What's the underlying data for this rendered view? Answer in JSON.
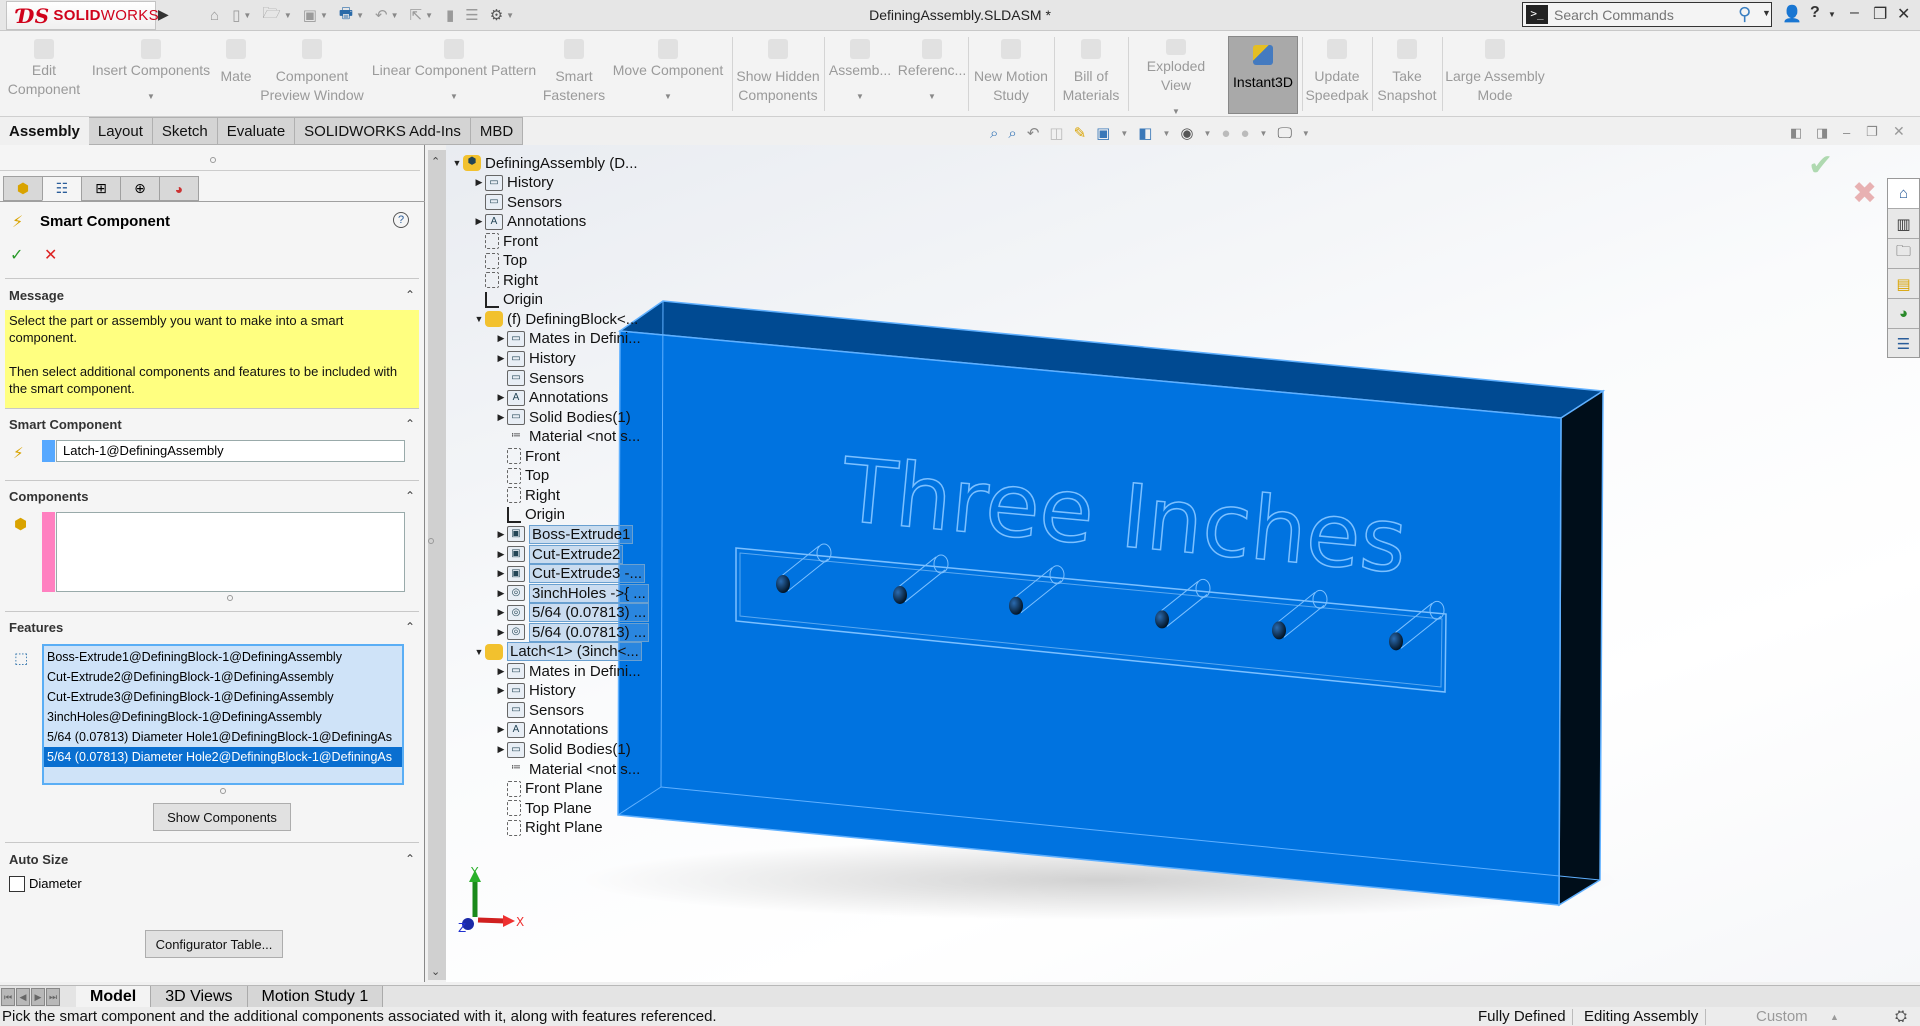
{
  "app": {
    "logo_prefix": "ƊS",
    "logo_bold": "SOLID",
    "logo_light": "WORKS",
    "document_title": "DefiningAssembly.SLDASM *"
  },
  "search": {
    "placeholder": "Search Commands"
  },
  "quick_access": [
    "home-icon",
    "new-document-icon",
    "open-icon",
    "save-icon",
    "print-icon",
    "undo-icon",
    "select-icon",
    "rebuild-icon",
    "file-properties-icon",
    "options-icon"
  ],
  "command_manager": {
    "commands": [
      {
        "label": "Edit\nComponent",
        "has_menu": false,
        "active": false
      },
      {
        "label": "Insert Components",
        "has_menu": true,
        "active": false
      },
      {
        "label": "Mate",
        "has_menu": false,
        "active": false
      },
      {
        "label": "Component\nPreview Window",
        "has_menu": false,
        "active": false
      },
      {
        "label": "Linear Component Pattern",
        "has_menu": true,
        "active": false
      },
      {
        "label": "Smart\nFasteners",
        "has_menu": false,
        "active": false
      },
      {
        "label": "Move Component",
        "has_menu": true,
        "active": false
      },
      {
        "label": "Show Hidden\nComponents",
        "has_menu": false,
        "active": false
      },
      {
        "label": "Assemb...",
        "has_menu": true,
        "active": false
      },
      {
        "label": "Referenc...",
        "has_menu": true,
        "active": false
      },
      {
        "label": "New Motion\nStudy",
        "has_menu": false,
        "active": false
      },
      {
        "label": "Bill of\nMaterials",
        "has_menu": false,
        "active": false
      },
      {
        "label": "Exploded View",
        "has_menu": true,
        "active": false
      },
      {
        "label": "Instant3D",
        "has_menu": false,
        "active": true
      },
      {
        "label": "Update\nSpeedpak",
        "has_menu": false,
        "active": false
      },
      {
        "label": "Take\nSnapshot",
        "has_menu": false,
        "active": false
      },
      {
        "label": "Large Assembly\nMode",
        "has_menu": false,
        "active": false
      }
    ],
    "tabs": [
      "Assembly",
      "Layout",
      "Sketch",
      "Evaluate",
      "SOLIDWORKS Add-Ins",
      "MBD"
    ],
    "active_tab": "Assembly"
  },
  "property_manager": {
    "title": "Smart Component",
    "ok_label": "✓",
    "cancel_label": "✕",
    "help_label": "?",
    "message": {
      "title": "Message",
      "line1": "Select the part or assembly you want to make into a smart component.",
      "line2": "Then select additional components and features to be included with the smart component."
    },
    "smart_component": {
      "title": "Smart Component",
      "value": "Latch-1@DefiningAssembly"
    },
    "components": {
      "title": "Components",
      "items": []
    },
    "features": {
      "title": "Features",
      "items": [
        "Boss-Extrude1@DefiningBlock-1@DefiningAssembly",
        "Cut-Extrude2@DefiningBlock-1@DefiningAssembly",
        "Cut-Extrude3@DefiningBlock-1@DefiningAssembly",
        "3inchHoles@DefiningBlock-1@DefiningAssembly",
        "5/64 (0.07813) Diameter Hole1@DefiningBlock-1@DefiningAs",
        "5/64 (0.07813) Diameter Hole2@DefiningBlock-1@DefiningAs"
      ],
      "selected_index": 5,
      "show_components_label": "Show Components"
    },
    "auto_size": {
      "title": "Auto Size",
      "diameter_label": "Diameter",
      "diameter_checked": false
    },
    "configurator_label": "Configurator Table..."
  },
  "feature_tree": [
    {
      "label": "DefiningAssembly  (D...",
      "icon": "assembly",
      "expander": "down",
      "level": 0,
      "highlight": false
    },
    {
      "label": "History",
      "icon": "folder",
      "expander": "right",
      "level": 1,
      "highlight": false
    },
    {
      "label": "Sensors",
      "icon": "folder",
      "expander": "",
      "level": 1,
      "highlight": false
    },
    {
      "label": "Annotations",
      "icon": "annotation",
      "expander": "right",
      "level": 1,
      "highlight": false
    },
    {
      "label": "Front",
      "icon": "plane",
      "expander": "",
      "level": 1,
      "highlight": false
    },
    {
      "label": "Top",
      "icon": "plane",
      "expander": "",
      "level": 1,
      "highlight": false
    },
    {
      "label": "Right",
      "icon": "plane",
      "expander": "",
      "level": 1,
      "highlight": false
    },
    {
      "label": "Origin",
      "icon": "origin",
      "expander": "",
      "level": 1,
      "highlight": false
    },
    {
      "label": "(f) DefiningBlock<...",
      "icon": "part",
      "expander": "down",
      "level": 1,
      "highlight": false
    },
    {
      "label": "Mates in Defini...",
      "icon": "folder",
      "expander": "right",
      "level": 2,
      "highlight": false
    },
    {
      "label": "History",
      "icon": "folder",
      "expander": "right",
      "level": 2,
      "highlight": false
    },
    {
      "label": "Sensors",
      "icon": "folder",
      "expander": "",
      "level": 2,
      "highlight": false
    },
    {
      "label": "Annotations",
      "icon": "annotation",
      "expander": "right",
      "level": 2,
      "highlight": false
    },
    {
      "label": "Solid Bodies(1)",
      "icon": "folder",
      "expander": "right",
      "level": 2,
      "highlight": false
    },
    {
      "label": "Material <not s...",
      "icon": "material",
      "expander": "",
      "level": 2,
      "highlight": false
    },
    {
      "label": "Front",
      "icon": "plane",
      "expander": "",
      "level": 2,
      "highlight": false
    },
    {
      "label": "Top",
      "icon": "plane",
      "expander": "",
      "level": 2,
      "highlight": false
    },
    {
      "label": "Right",
      "icon": "plane",
      "expander": "",
      "level": 2,
      "highlight": false
    },
    {
      "label": "Origin",
      "icon": "origin",
      "expander": "",
      "level": 2,
      "highlight": false
    },
    {
      "label": "Boss-Extrude1",
      "icon": "feature",
      "expander": "right",
      "level": 2,
      "highlight": true
    },
    {
      "label": "Cut-Extrude2",
      "icon": "feature",
      "expander": "right",
      "level": 2,
      "highlight": true
    },
    {
      "label": "Cut-Extrude3 -...",
      "icon": "feature",
      "expander": "right",
      "level": 2,
      "highlight": true
    },
    {
      "label": "3inchHoles ->{ ...",
      "icon": "hole",
      "expander": "right",
      "level": 2,
      "highlight": true
    },
    {
      "label": "5/64 (0.07813) ...",
      "icon": "hole",
      "expander": "right",
      "level": 2,
      "highlight": true
    },
    {
      "label": "5/64 (0.07813) ...",
      "icon": "hole",
      "expander": "right",
      "level": 2,
      "highlight": true
    },
    {
      "label": "Latch<1> (3inch<...",
      "icon": "part",
      "expander": "down",
      "level": 1,
      "highlight": true
    },
    {
      "label": "Mates in Defini...",
      "icon": "folder",
      "expander": "right",
      "level": 2,
      "highlight": false
    },
    {
      "label": "History",
      "icon": "folder",
      "expander": "right",
      "level": 2,
      "highlight": false
    },
    {
      "label": "Sensors",
      "icon": "folder",
      "expander": "",
      "level": 2,
      "highlight": false
    },
    {
      "label": "Annotations",
      "icon": "annotation",
      "expander": "right",
      "level": 2,
      "highlight": false
    },
    {
      "label": "Solid Bodies(1)",
      "icon": "folder",
      "expander": "right",
      "level": 2,
      "highlight": false
    },
    {
      "label": "Material <not s...",
      "icon": "material",
      "expander": "",
      "level": 2,
      "highlight": false
    },
    {
      "label": "Front Plane",
      "icon": "plane",
      "expander": "",
      "level": 2,
      "highlight": false
    },
    {
      "label": "Top Plane",
      "icon": "plane",
      "expander": "",
      "level": 2,
      "highlight": false
    },
    {
      "label": "Right Plane",
      "icon": "plane",
      "expander": "",
      "level": 2,
      "highlight": false
    }
  ],
  "viewport": {
    "engraved_text": "Three Inches",
    "hole_count": 6,
    "triad": {
      "x": "X",
      "y": "Y",
      "z": "Z"
    },
    "colors": {
      "body_front": "#0073e0",
      "body_top": "#004a92",
      "body_side": "#000e1a",
      "edge": "#5fb0ff"
    }
  },
  "heads_up_toolbar": [
    "zoom-to-fit-icon",
    "zoom-to-area-icon",
    "previous-view-icon",
    "section-view-icon",
    "dynamic-annotation-icon",
    "view-orientation-icon",
    "display-style-icon",
    "hide-show-icon",
    "edit-appearance-icon",
    "apply-scene-icon",
    "view-settings-icon"
  ],
  "task_pane": [
    "home-icon",
    "design-library-icon",
    "file-explorer-icon",
    "view-palette-icon",
    "appearances-icon",
    "custom-properties-icon"
  ],
  "bottom_tabs": [
    "Model",
    "3D Views",
    "Motion Study 1"
  ],
  "active_bottom_tab": "Model",
  "status": {
    "message": "Pick the smart component and the additional components associated with it, along with features referenced.",
    "definition": "Fully Defined",
    "mode": "Editing Assembly",
    "units": "Custom"
  }
}
